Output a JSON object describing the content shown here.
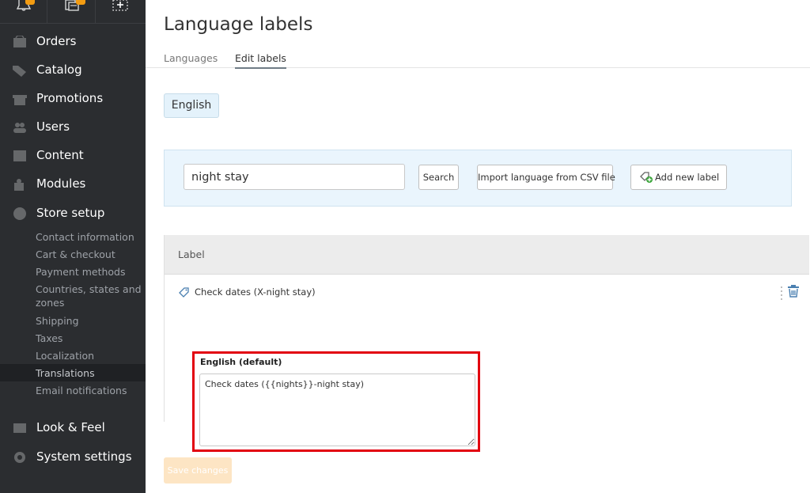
{
  "sidebar": {
    "top_icons": [
      "bell-icon",
      "documents-icon",
      "add-icon"
    ],
    "items": [
      {
        "label": "Orders",
        "icon": "orders-icon"
      },
      {
        "label": "Catalog",
        "icon": "tag-icon"
      },
      {
        "label": "Promotions",
        "icon": "gift-icon"
      },
      {
        "label": "Users",
        "icon": "users-icon"
      },
      {
        "label": "Content",
        "icon": "content-icon"
      },
      {
        "label": "Modules",
        "icon": "puzzle-icon"
      },
      {
        "label": "Store setup",
        "icon": "info-icon"
      }
    ],
    "store_setup_sub": [
      {
        "label": "Contact information"
      },
      {
        "label": "Cart & checkout"
      },
      {
        "label": "Payment methods"
      },
      {
        "label": "Countries, states and zones"
      },
      {
        "label": "Shipping"
      },
      {
        "label": "Taxes"
      },
      {
        "label": "Localization"
      },
      {
        "label": "Translations",
        "active": true
      },
      {
        "label": "Email notifications"
      }
    ],
    "bottom_items": [
      {
        "label": "Look & Feel",
        "icon": "image-icon"
      },
      {
        "label": "System settings",
        "icon": "gear-icon"
      }
    ]
  },
  "header": {
    "title": "Language labels",
    "tabs": [
      {
        "label": "Languages"
      },
      {
        "label": "Edit labels",
        "active": true
      }
    ]
  },
  "language_badge": "English",
  "search": {
    "value": "night stay",
    "search_button": "Search",
    "import_button": "Import language from CSV file",
    "add_button": "Add new label"
  },
  "table": {
    "column_header": "Label",
    "rows": [
      {
        "name": "Check dates (X-night stay)",
        "field_label": "English (default)",
        "value": "Check dates ({{nights}}-night stay)"
      }
    ]
  },
  "save_button": "Save changes",
  "colors": {
    "sidebar_bg": "#2b2d30",
    "badge": "#f39c12",
    "highlight": "#e2000f",
    "panel_bg": "#eaf5fd",
    "save_btn": "#fde5c4"
  }
}
